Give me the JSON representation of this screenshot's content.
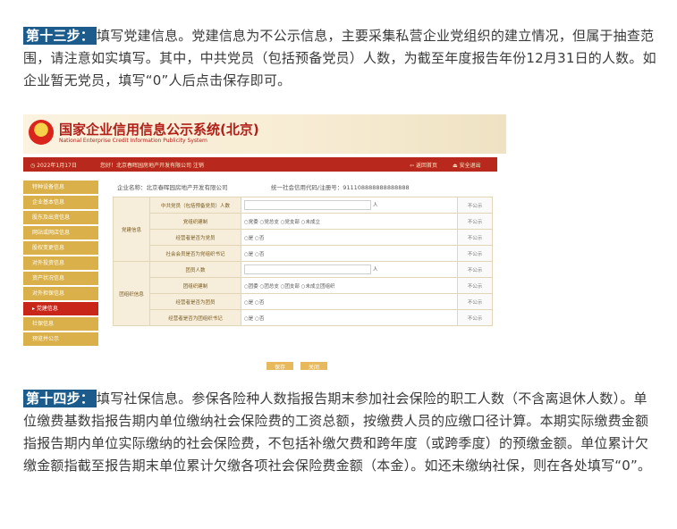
{
  "step13": {
    "label": "第十三步：",
    "text": "填写党建信息。党建信息为不公示信息，主要采集私营企业党组织的建立情况，但属于抽查范围，请注意如实填写。其中，中共党员（包括预备党员）人数，为截至年度报告年份12月31日的人数。如企业暂无党员，填写“0”人后点击保存即可。"
  },
  "screenshot": {
    "system_title_cn": "国家企业信用信息公示系统(北京)",
    "system_title_en": "National Enterprise Credit Information Publicity System",
    "date": "2022年1月17日",
    "breadcrumb": "您好！北京春晖园房地产开发有限公司 注销",
    "home_label": "返回首页",
    "exit_label": "安全退出",
    "menu": [
      "特种设备信息",
      "企业基本信息",
      "股东及出资信息",
      "网站或网店信息",
      "股权变更信息",
      "对外投资信息",
      "资产状况信息",
      "对外担保信息",
      "党建信息",
      "社保信息",
      "预览并公示"
    ],
    "company_label": "企业名称：北京春晖园房地产开发有限公司",
    "credit_label": "统一社会信用代码/注册号：911108888888888888",
    "groups": {
      "party": "党建信息",
      "league": "团组织信息"
    },
    "rows": [
      {
        "label": "中共党员（包括预备党员）人数",
        "type": "input",
        "unit": "人",
        "pub": "不公示"
      },
      {
        "label": "党组织建制",
        "type": "options",
        "options": "○党委 ○党总支 ○党支部 ○未成立",
        "pub": "不公示"
      },
      {
        "label": "经营者是否为党员",
        "type": "options",
        "options": "○是  ○否",
        "pub": "不公示"
      },
      {
        "label": "社会会员是否为党组织书记",
        "type": "options",
        "options": "○是  ○否",
        "pub": "不公示"
      },
      {
        "label": "团员人数",
        "type": "input",
        "unit": "人",
        "pub": "不公示"
      },
      {
        "label": "团组织建制",
        "type": "options",
        "options": "○团委 ○团总支 ○团支部 ○未成立团组织",
        "pub": "不公示"
      },
      {
        "label": "经营者是否为团员",
        "type": "options",
        "options": "○是  ○否",
        "pub": "不公示"
      },
      {
        "label": "经营者是否为团组织书记",
        "type": "options",
        "options": "○是  ○否",
        "pub": "不公示"
      }
    ],
    "save_label": "保存",
    "close_label": "关闭"
  },
  "step14": {
    "label": "第十四步：",
    "text": "填写社保信息。参保各险种人数指报告期末参加社会保险的职工人数（不含离退休人数）。单位缴费基数指报告期内单位缴纳社会保险费的工资总额，按缴费人员的应缴口径计算。本期实际缴费金额指报告期内单位实际缴纳的社会保险费，不包括补缴欠费和跨年度（或跨季度）的预缴金额。单位累计欠缴金额指截至报告期末单位累计欠缴各项社会保险费金额（本金）。如还未缴纳社保，则在各处填写“0”。"
  }
}
